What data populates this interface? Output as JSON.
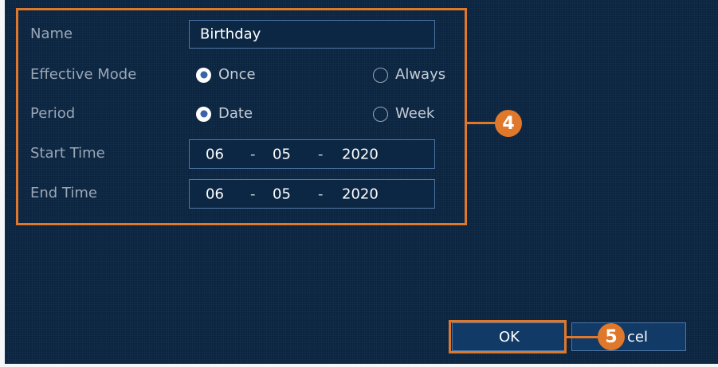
{
  "form": {
    "name_label": "Name",
    "name_value": "Birthday",
    "effective_mode_label": "Effective Mode",
    "effective_mode_options": [
      {
        "label": "Once",
        "selected": true
      },
      {
        "label": "Always",
        "selected": false
      }
    ],
    "period_label": "Period",
    "period_options": [
      {
        "label": "Date",
        "selected": true
      },
      {
        "label": "Week",
        "selected": false
      }
    ],
    "start_time_label": "Start Time",
    "start_time": {
      "month": "06",
      "day": "05",
      "year": "2020",
      "separator": "-"
    },
    "end_time_label": "End Time",
    "end_time": {
      "month": "06",
      "day": "05",
      "year": "2020",
      "separator": "-"
    }
  },
  "buttons": {
    "ok_label": "OK",
    "cancel_label_visible": "cel"
  },
  "callouts": {
    "form_step": "4",
    "ok_step": "5"
  },
  "colors": {
    "background": "#0b2541",
    "accent": "#e0782b",
    "field_border": "#4f77a7",
    "radio_selected": "#3b63a8"
  }
}
